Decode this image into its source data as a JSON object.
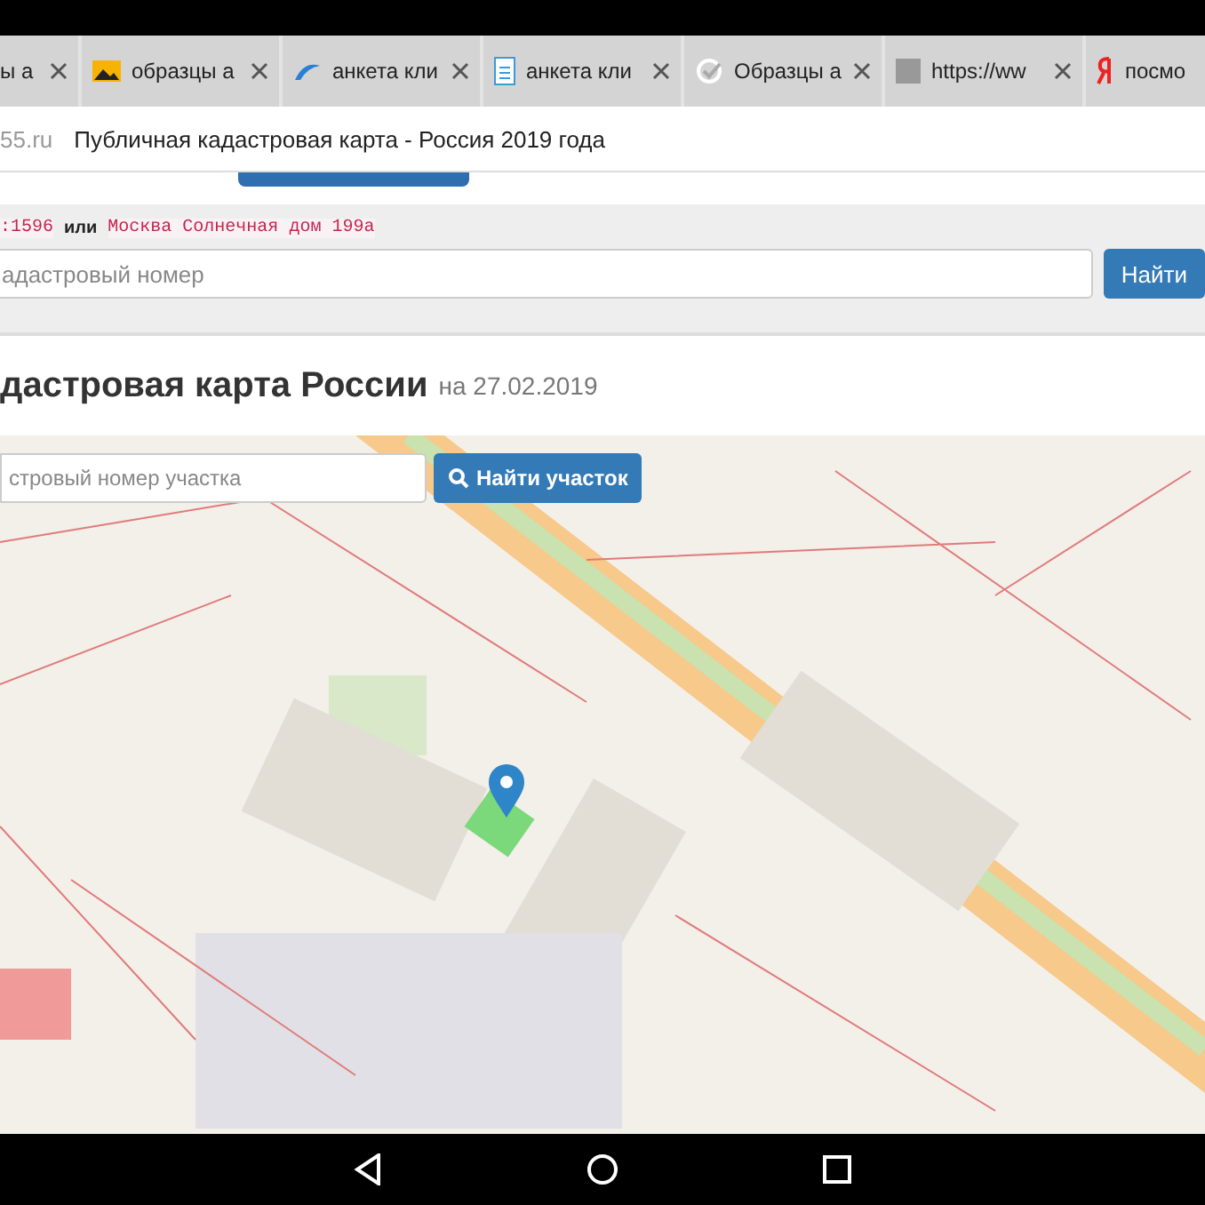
{
  "tabs": [
    {
      "title": "ы а",
      "kind": "plain"
    },
    {
      "title": "образцы а",
      "kind": "image"
    },
    {
      "title": "анкета кли",
      "kind": "wave"
    },
    {
      "title": "анкета кли",
      "kind": "doc"
    },
    {
      "title": "Образцы а",
      "kind": "check"
    },
    {
      "title": "https://ww",
      "kind": "grey"
    },
    {
      "title": "посмо",
      "kind": "ya"
    }
  ],
  "address_bar": {
    "domain": "55.ru",
    "page_title": "Публичная кадастровая карта - Россия 2019 года"
  },
  "search_panel": {
    "example_1": ":1596",
    "joiner": "или",
    "example_2": "Москва Солнечная дом 199а",
    "placeholder": "адастровый номер",
    "button": "Найти"
  },
  "heading": {
    "title": "дастровая карта России",
    "date": "на 27.02.2019"
  },
  "map": {
    "placeholder": "стровый номер участка",
    "button": "Найти участок"
  }
}
